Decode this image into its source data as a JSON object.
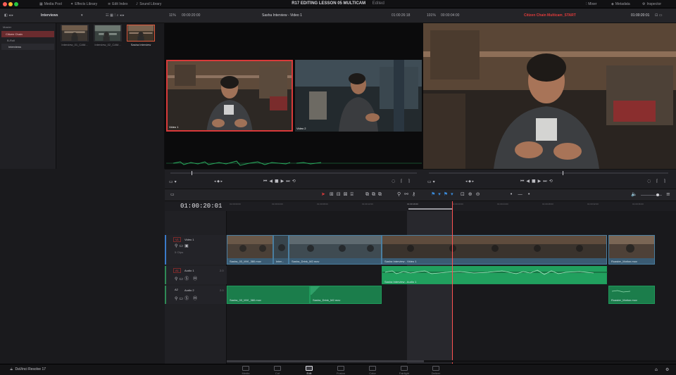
{
  "window": {
    "title": "R17 EDITING LESSON 05 MULTICAM",
    "status": "Edited",
    "top_buttons": [
      "Media Pool",
      "Effects Library",
      "Edit Index",
      "Sound Library"
    ],
    "right_buttons": [
      "Mixer",
      "Metadata",
      "Inspector"
    ]
  },
  "toolbar": {
    "bin_name": "Interviews",
    "zoom": "11%",
    "source_timecode": "00:00:20:00",
    "viewer_title": "Sasha Interview - Video 1",
    "duration": "01:00:26:18",
    "prog_zoom": "101%",
    "prog_timecode": "00:00:04:00",
    "timeline_name": "Citizen Chain Multicam_START",
    "record_timecode": "01:00:20:01"
  },
  "media_pool": {
    "root": "Master",
    "folders": [
      "Citizen Chain",
      "B-Roll",
      "Interviews"
    ],
    "smart_bins_label": "Smart Bins",
    "smart_bins_items": [
      "Keywords"
    ],
    "clips": [
      {
        "name": "Interview_01_CAM..."
      },
      {
        "name": "Interview_02_CAM..."
      },
      {
        "name": "Sasha Interview"
      }
    ]
  },
  "multicam": {
    "angles": [
      "Video 1",
      "Video 2"
    ]
  },
  "timeline": {
    "current_timecode": "01:00:20:01",
    "ruler_ticks": [
      "01:00:00:00",
      "01:00:04:00",
      "01:00:08:00",
      "01:00:12:00",
      "01:00:16:00",
      "01:00:20:00",
      "01:00:24:00",
      "01:00:28:00",
      "01:00:32:00",
      "01:00:36:00",
      "01:00:40:00"
    ],
    "tracks": [
      {
        "id": "V1",
        "name": "Video 1",
        "clips_count": "5 Clips"
      },
      {
        "id": "A1",
        "name": "Audio 1",
        "level": "2.0"
      },
      {
        "id": "A2",
        "name": "Audio 2",
        "level": "2.0"
      }
    ],
    "clip_labels": {
      "v1_a": "Sasha_03_MVI_380.mov",
      "v1_b": "Inter...",
      "v1_c": "Sasha_Drink_M2.mov",
      "v1_d": "Sasha Interview - Video 1",
      "v1_e": "Roaster_Motion.mov",
      "a1_main": "Sasha Interview - Audio 1",
      "a2_a": "Sasha_03_MVI_380.mov",
      "a2_b": "Sasha_Drink_M2.mov",
      "a2_c": "Roaster_Motion.mov"
    }
  },
  "pages": [
    {
      "label": "Media",
      "active": false
    },
    {
      "label": "Cut",
      "active": false
    },
    {
      "label": "Edit",
      "active": true
    },
    {
      "label": "Fusion",
      "active": false
    },
    {
      "label": "Color",
      "active": false
    },
    {
      "label": "Fairlight",
      "active": false
    },
    {
      "label": "Deliver",
      "active": false
    }
  ],
  "app_name": "DaVinci Resolve 17",
  "colors": {
    "accent_red": "#e03b3b",
    "video_clip": "#3a5b73",
    "audio_clip": "#1b7d4b",
    "timeline_red": "#ff5252"
  }
}
